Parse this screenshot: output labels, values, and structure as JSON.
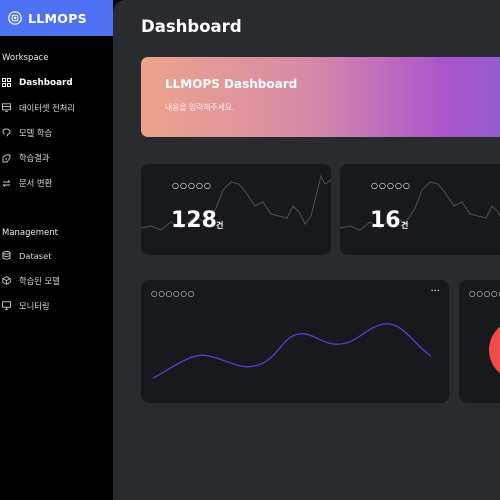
{
  "brand": {
    "name": "LLMOPS",
    "icon": "chip-icon",
    "color": "#4d73f4"
  },
  "sidebar": {
    "workspace_title": "Workspace",
    "workspace_items": [
      {
        "label": "Dashboard",
        "icon": "grid-icon",
        "active": true
      },
      {
        "label": "데이터셋 전처리",
        "icon": "dataset-icon",
        "active": false
      },
      {
        "label": "모델 학습",
        "icon": "brain-icon",
        "active": false
      },
      {
        "label": "학습결과",
        "icon": "result-icon",
        "active": false
      },
      {
        "label": "문서 변환",
        "icon": "convert-icon",
        "active": false
      }
    ],
    "management_title": "Management",
    "management_items": [
      {
        "label": "Dataset",
        "icon": "database-icon",
        "active": false
      },
      {
        "label": "학습된 모델",
        "icon": "cube-icon",
        "active": false
      },
      {
        "label": "모니터링",
        "icon": "monitor-icon",
        "active": false
      }
    ]
  },
  "main": {
    "title": "Dashboard",
    "banner": {
      "title": "LLMOPS Dashboard",
      "subtitle": "내용을 입력해주세요."
    },
    "stats": [
      {
        "label": "○○○○○",
        "value": "128",
        "unit": "건"
      },
      {
        "label": "○○○○○",
        "value": "16",
        "unit": "건"
      }
    ],
    "charts": [
      {
        "label": "○○○○○○",
        "more": "···",
        "line_color": "#5b3fd8"
      },
      {
        "label": "○○○○○○",
        "accent": "#f04a4a"
      }
    ]
  }
}
